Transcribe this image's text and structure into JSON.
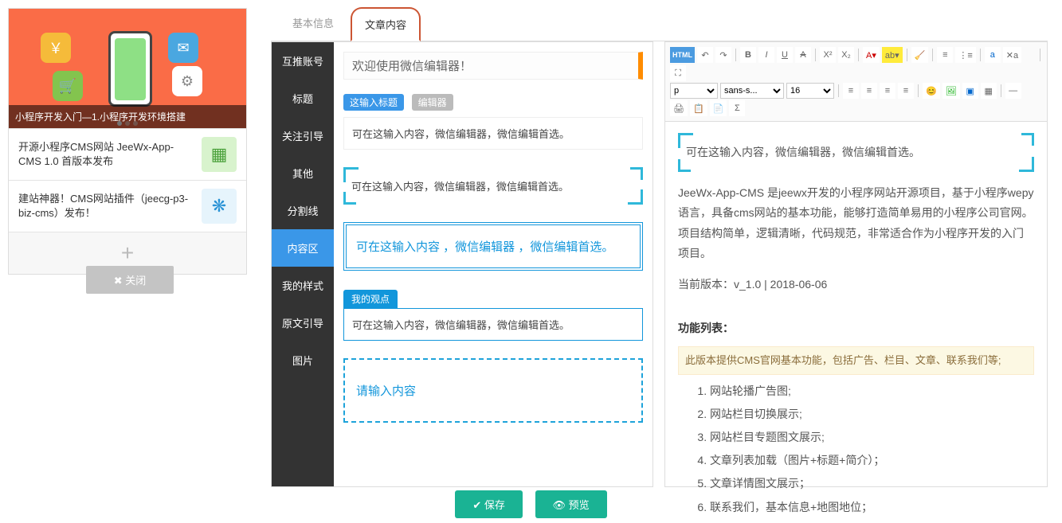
{
  "tabs": {
    "basic": "基本信息",
    "content": "文章内容"
  },
  "left": {
    "hero_caption": "小程序开发入门—1.小程序开发环境搭建",
    "items": [
      "开源小程序CMS网站 JeeWx-App-CMS 1.0 首版本发布",
      "建站神器！CMS网站插件（jeecg-p3-biz-cms）发布！"
    ],
    "add_label": "+",
    "close_label": "✖ 关闭"
  },
  "side_menu": [
    "互推账号",
    "标题",
    "关注引导",
    "其他",
    "分割线",
    "内容区",
    "我的样式",
    "原文引导",
    "图片"
  ],
  "templates": {
    "welcome": "欢迎使用微信编辑器！",
    "tag_title": "这输入标题",
    "tag_editor": "编辑器",
    "box_text": "可在这输入内容，微信编辑器，微信编辑首选。",
    "double_text": "可在这输入内容 ，微信编辑器 ，微信编辑首选。",
    "my_point_label": "我的观点",
    "dashed_text": "请输入内容"
  },
  "rte": {
    "font_format": "p",
    "font_family": "sans-s...",
    "font_size": "16",
    "bracket_text": "可在这输入内容，微信编辑器，微信编辑首选。",
    "p1": "JeeWx-App-CMS 是jeewx开发的小程序网站开源项目，基于小程序wepy语言，具备cms网站的基本功能，能够打造简单易用的小程序公司官网。项目结构简单，逻辑清晰，代码规范，非常适合作为小程序开发的入门项目。",
    "version": "当前版本：v_1.0 | 2018-06-06",
    "section_title": "功能列表：",
    "banner": "此版本提供CMS官网基本功能，包括广告、栏目、文章、联系我们等;",
    "features": [
      "网站轮播广告图;",
      "网站栏目切换展示;",
      "网站栏目专题图文展示;",
      "文章列表加载（图片+标题+简介）；",
      "文章详情图文展示；",
      "联系我们，基本信息+地图地位；"
    ]
  },
  "actions": {
    "save": "✔ 保存",
    "preview": "👁 预览"
  }
}
